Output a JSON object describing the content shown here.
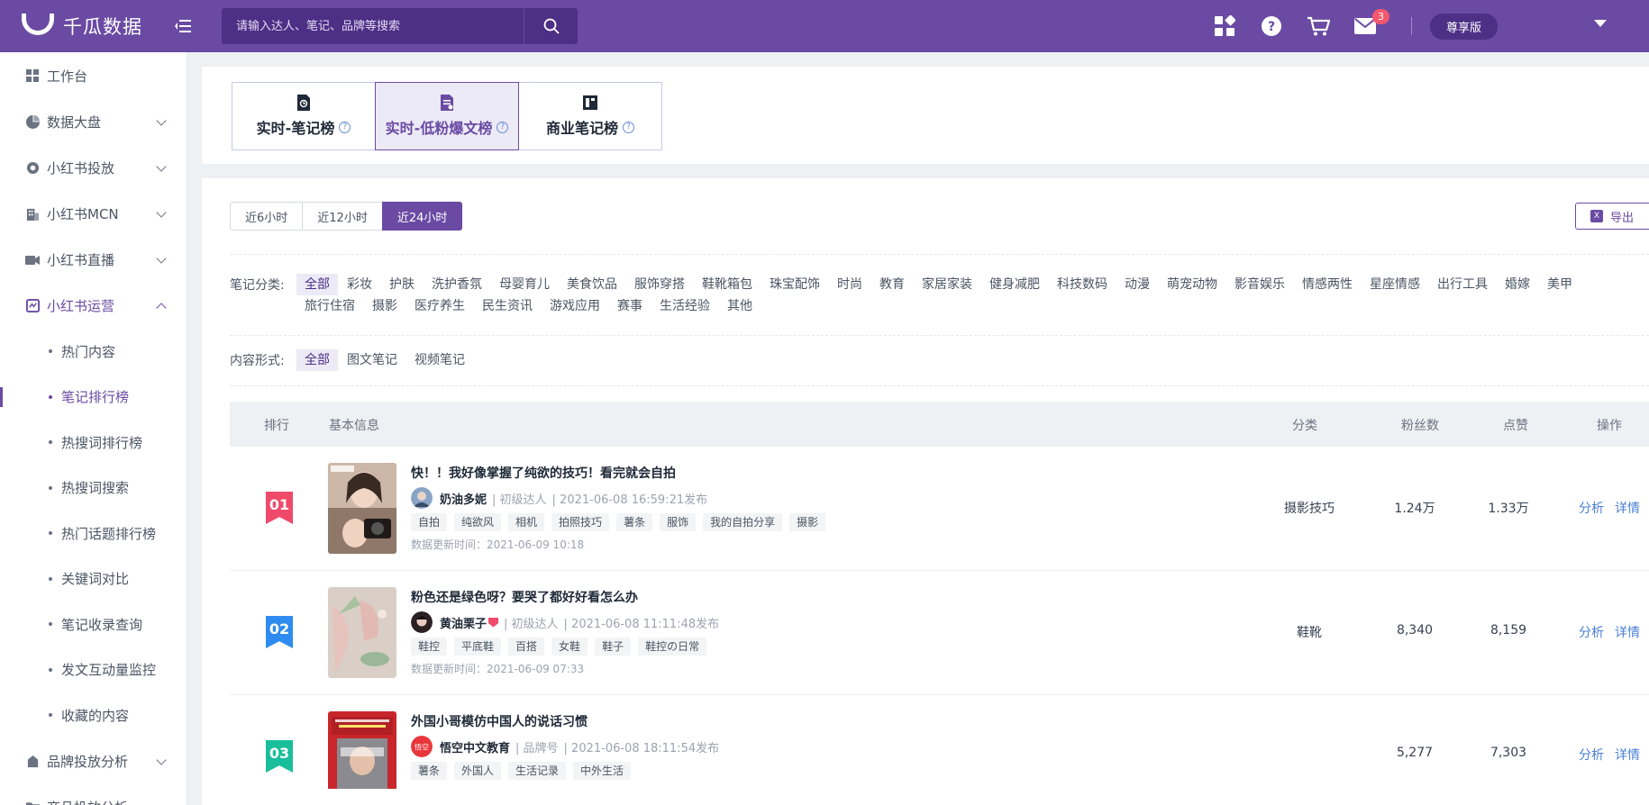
{
  "header": {
    "logo_text": "千瓜数据",
    "search_placeholder": "请输入达人、笔记、品牌等搜索",
    "message_badge": "3",
    "vip_label": "尊享版"
  },
  "sidebar": {
    "items": [
      {
        "label": "工作台"
      },
      {
        "label": "数据大盘"
      },
      {
        "label": "小红书投放"
      },
      {
        "label": "小红书MCN"
      },
      {
        "label": "小红书直播"
      },
      {
        "label": "小红书运营"
      }
    ],
    "sub_items": [
      {
        "label": "热门内容"
      },
      {
        "label": "笔记排行榜"
      },
      {
        "label": "热搜词排行榜"
      },
      {
        "label": "热搜词搜索"
      },
      {
        "label": "热门话题排行榜"
      },
      {
        "label": "关键词对比"
      },
      {
        "label": "笔记收录查询"
      },
      {
        "label": "发文互动量监控"
      },
      {
        "label": "收藏的内容"
      }
    ],
    "after_items": [
      {
        "label": "品牌投放分析"
      },
      {
        "label": "商品投放分析"
      }
    ]
  },
  "rank_tabs": [
    {
      "label": "实时-笔记榜"
    },
    {
      "label": "实时-低粉爆文榜"
    },
    {
      "label": "商业笔记榜"
    }
  ],
  "time_tabs": [
    {
      "label": "近6小时"
    },
    {
      "label": "近12小时"
    },
    {
      "label": "近24小时"
    }
  ],
  "export_label": "导出",
  "category_filter": {
    "label": "笔记分类:",
    "options": [
      "全部",
      "彩妆",
      "护肤",
      "洗护香氛",
      "母婴育儿",
      "美食饮品",
      "服饰穿搭",
      "鞋靴箱包",
      "珠宝配饰",
      "时尚",
      "教育",
      "家居家装",
      "健身减肥",
      "科技数码",
      "动漫",
      "萌宠动物",
      "影音娱乐",
      "情感两性",
      "星座情感",
      "出行工具",
      "婚嫁",
      "美甲",
      "旅行住宿",
      "摄影",
      "医疗养生",
      "民生资讯",
      "游戏应用",
      "赛事",
      "生活经验",
      "其他"
    ]
  },
  "format_filter": {
    "label": "内容形式:",
    "options": [
      "全部",
      "图文笔记",
      "视频笔记"
    ]
  },
  "table": {
    "headers": {
      "rank": "排行",
      "info": "基本信息",
      "category": "分类",
      "fans": "粉丝数",
      "likes": "点赞",
      "ops": "操作"
    },
    "rows": [
      {
        "rank": "01",
        "title": "快！！我好像掌握了纯欲的技巧！看完就会自拍",
        "author": "奶油多妮",
        "level": "| 初级达人",
        "published": "| 2021-06-08 16:59:21发布",
        "tags": [
          "自拍",
          "纯欲风",
          "相机",
          "拍照技巧",
          "薯条",
          "服饰",
          "我的自拍分享",
          "摄影"
        ],
        "updated": "数据更新时间：2021-06-09 10:18",
        "category": "摄影技巧",
        "fans": "1.24万",
        "likes": "1.33万",
        "op_analyze": "分析",
        "op_detail": "详情"
      },
      {
        "rank": "02",
        "title": "粉色还是绿色呀？要哭了都好好看怎么办",
        "author": "黄油栗子",
        "level": "| 初级达人",
        "published": "| 2021-06-08 11:11:48发布",
        "tags": [
          "鞋控",
          "平底鞋",
          "百搭",
          "女鞋",
          "鞋子",
          "鞋控の日常"
        ],
        "updated": "数据更新时间：2021-06-09 07:33",
        "category": "鞋靴",
        "fans": "8,340",
        "likes": "8,159",
        "op_analyze": "分析",
        "op_detail": "详情"
      },
      {
        "rank": "03",
        "title": "外国小哥模仿中国人的说话习惯",
        "author": "悟空中文教育",
        "level": "| 品牌号",
        "published": "| 2021-06-08 18:11:54发布",
        "tags": [
          "薯条",
          "外国人",
          "生活记录",
          "中外生活"
        ],
        "updated": "",
        "category": "",
        "fans": "5,277",
        "likes": "7,303",
        "op_analyze": "分析",
        "op_detail": "详情"
      }
    ]
  },
  "colors": {
    "brand": "#6a4aa3",
    "rank1": "#f04a6b",
    "rank2": "#2e8cf0",
    "rank3": "#19be9a",
    "link": "#4a7fd6"
  }
}
